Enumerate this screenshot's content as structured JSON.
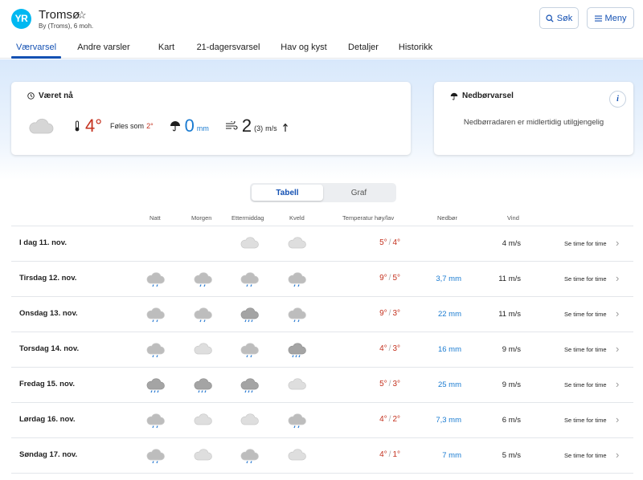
{
  "app": {
    "logo": "YR",
    "place": "Tromsø",
    "subtitle": "By (Troms), 6 moh."
  },
  "header": {
    "search_label": "Søk",
    "menu_label": "Meny"
  },
  "tabs": [
    {
      "label": "Værvarsel",
      "active": true
    },
    {
      "label": "Andre varsler"
    },
    {
      "label": "Kart"
    },
    {
      "label": "21-dagersvarsel"
    },
    {
      "label": "Hav og kyst"
    },
    {
      "label": "Detaljer"
    },
    {
      "label": "Historikk"
    }
  ],
  "now": {
    "title": "Været nå",
    "temp": "4°",
    "feels_label": "Føles som",
    "feels_value": "2°",
    "precip": "0",
    "precip_unit": "mm",
    "wind": "2",
    "gust": "(3)",
    "wind_unit": "m/s"
  },
  "precip_card": {
    "title": "Nedbørvarsel",
    "message": "Nedbørradaren er midlertidig utilgjengelig",
    "info": "i"
  },
  "view_toggle": {
    "table": "Tabell",
    "graph": "Graf"
  },
  "columns": {
    "night": "Natt",
    "morning": "Morgen",
    "afternoon": "Ettermiddag",
    "evening": "Kveld",
    "temp": "Temperatur høy/lav",
    "precip": "Nedbør",
    "wind": "Vind"
  },
  "colors": {
    "accent": "#1451b3",
    "warm": "#c4311e",
    "rain": "#1a7bd1"
  },
  "days": [
    {
      "label": "I dag 11. nov.",
      "icons": [
        "",
        "",
        "cloud-icon",
        "cloud-icon"
      ],
      "high": "5°",
      "low": "4°",
      "precip": "",
      "wind": "4 m/s",
      "detail": "Se time for time"
    },
    {
      "label": "Tirsdag 12. nov.",
      "icons": [
        "rain-icon",
        "rain-icon",
        "rain-icon",
        "rain-icon"
      ],
      "high": "9°",
      "low": "5°",
      "precip": "3,7 mm",
      "wind": "11 m/s",
      "detail": "Se time for time"
    },
    {
      "label": "Onsdag 13. nov.",
      "icons": [
        "rain-icon",
        "rain-icon",
        "heavy-rain-icon",
        "rain-icon"
      ],
      "high": "9°",
      "low": "3°",
      "precip": "22 mm",
      "wind": "11 m/s",
      "detail": "Se time for time"
    },
    {
      "label": "Torsdag 14. nov.",
      "icons": [
        "rain-icon",
        "cloud-icon",
        "rain-icon",
        "heavy-rain-icon"
      ],
      "high": "4°",
      "low": "3°",
      "precip": "16 mm",
      "wind": "9 m/s",
      "detail": "Se time for time"
    },
    {
      "label": "Fredag 15. nov.",
      "icons": [
        "heavy-rain-icon",
        "heavy-rain-icon",
        "heavy-rain-icon",
        "cloud-icon"
      ],
      "high": "5°",
      "low": "3°",
      "precip": "25 mm",
      "wind": "9 m/s",
      "detail": "Se time for time"
    },
    {
      "label": "Lørdag 16. nov.",
      "icons": [
        "rain-icon",
        "cloud-icon",
        "cloud-icon",
        "rain-icon"
      ],
      "high": "4°",
      "low": "2°",
      "precip": "7,3 mm",
      "wind": "6 m/s",
      "detail": "Se time for time"
    },
    {
      "label": "Søndag 17. nov.",
      "icons": [
        "rain-icon",
        "cloud-icon",
        "rain-icon",
        "cloud-icon"
      ],
      "high": "4°",
      "low": "1°",
      "precip": "7 mm",
      "wind": "5 m/s",
      "detail": "Se time for time"
    }
  ]
}
